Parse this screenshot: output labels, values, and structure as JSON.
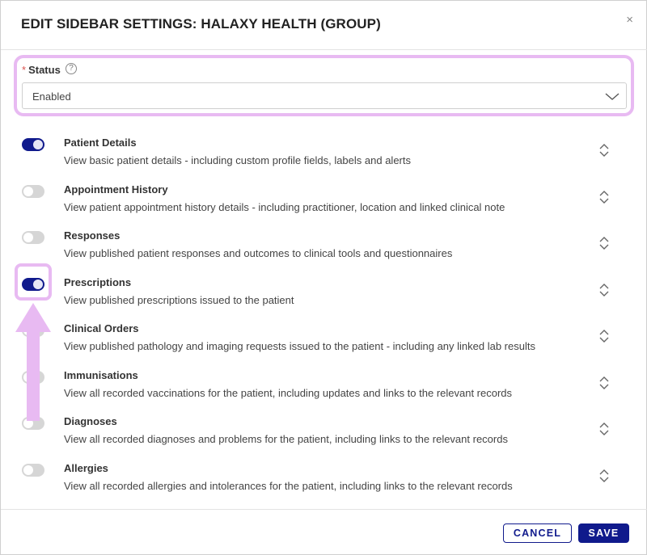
{
  "modal": {
    "title": "EDIT SIDEBAR SETTINGS: HALAXY HEALTH (GROUP)",
    "close_glyph": "×"
  },
  "status": {
    "required_mark": "*",
    "label": "Status",
    "help_glyph": "?",
    "selected_value": "Enabled"
  },
  "items": [
    {
      "title": "Patient Details",
      "description": "View basic patient details - including custom profile fields, labels and alerts",
      "enabled": true
    },
    {
      "title": "Appointment History",
      "description": "View patient appointment history details - including practitioner, location and linked clinical note",
      "enabled": false
    },
    {
      "title": "Responses",
      "description": "View published patient responses and outcomes to clinical tools and questionnaires",
      "enabled": false
    },
    {
      "title": "Prescriptions",
      "description": "View published prescriptions issued to the patient",
      "enabled": true
    },
    {
      "title": "Clinical Orders",
      "description": "View published pathology and imaging requests issued to the patient - including any linked lab results",
      "enabled": false
    },
    {
      "title": "Immunisations",
      "description": "View all recorded vaccinations for the patient, including updates and links to the relevant records",
      "enabled": false
    },
    {
      "title": "Diagnoses",
      "description": "View all recorded diagnoses and problems for the patient, including links to the relevant records",
      "enabled": false
    },
    {
      "title": "Allergies",
      "description": "View all recorded allergies and intolerances for the patient, including links to the relevant records",
      "enabled": false
    }
  ],
  "footer": {
    "cancel_label": "CANCEL",
    "save_label": "SAVE"
  },
  "colors": {
    "accent": "#101a8c",
    "highlight": "#e8baf2",
    "toggle_off": "#d6d6d6"
  },
  "icons": {
    "close": "close-icon",
    "help": "help-circle-icon",
    "dropdown": "chevron-down-icon",
    "reorder": "sort-handle-icon",
    "annotation": "arrow-up-icon"
  }
}
